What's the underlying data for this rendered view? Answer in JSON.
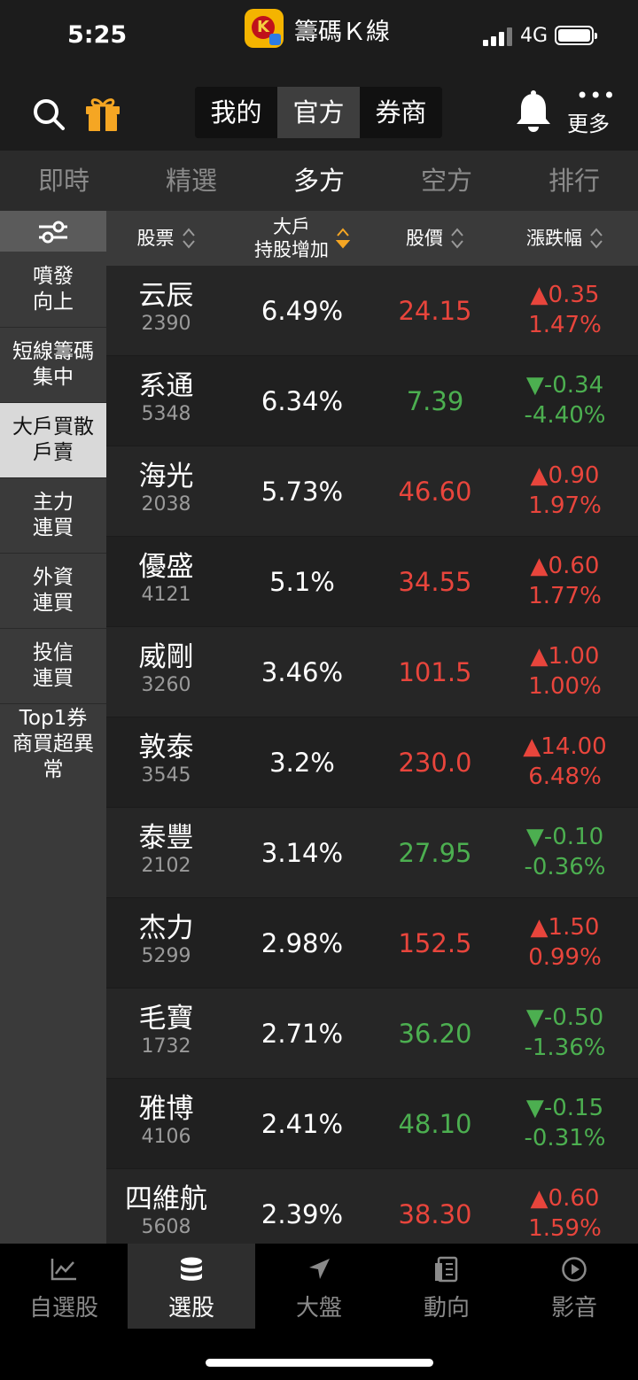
{
  "status": {
    "time": "5:25",
    "app_name": "籌碼Ｋ線",
    "network": "4G",
    "app_badge_letter": "K"
  },
  "header": {
    "segments": [
      {
        "label": "我的"
      },
      {
        "label": "官方"
      },
      {
        "label": "券商"
      }
    ],
    "active_segment": "官方",
    "more_label": "更多",
    "more_dots": "•••"
  },
  "tabs": [
    {
      "label": "即時"
    },
    {
      "label": "精選"
    },
    {
      "label": "多方"
    },
    {
      "label": "空方"
    },
    {
      "label": "排行"
    }
  ],
  "active_tab": "多方",
  "sidebar": {
    "items": [
      {
        "label": "噴發\n向上"
      },
      {
        "label": "短線籌碼\n集中"
      },
      {
        "label": "大戶買散\n戶賣"
      },
      {
        "label": "主力\n連買"
      },
      {
        "label": "外資\n連買"
      },
      {
        "label": "投信\n連買"
      },
      {
        "label": "Top1券\n商買超異\n常"
      }
    ],
    "active_item": "大戶買散戶賣"
  },
  "table": {
    "columns": [
      {
        "label": "股票"
      },
      {
        "label": "大戶\n持股增加"
      },
      {
        "label": "股價"
      },
      {
        "label": "漲跌幅"
      }
    ],
    "sorted_column": "大戶持股增加",
    "rows": [
      {
        "name": "云辰",
        "code": "2390",
        "pct": "6.49%",
        "price": "24.15",
        "change": "▲0.35",
        "change_pct": "1.47%",
        "dir": "up"
      },
      {
        "name": "系通",
        "code": "5348",
        "pct": "6.34%",
        "price": "7.39",
        "change": "▼-0.34",
        "change_pct": "-4.40%",
        "dir": "down"
      },
      {
        "name": "海光",
        "code": "2038",
        "pct": "5.73%",
        "price": "46.60",
        "change": "▲0.90",
        "change_pct": "1.97%",
        "dir": "up"
      },
      {
        "name": "優盛",
        "code": "4121",
        "pct": "5.1%",
        "price": "34.55",
        "change": "▲0.60",
        "change_pct": "1.77%",
        "dir": "up"
      },
      {
        "name": "威剛",
        "code": "3260",
        "pct": "3.46%",
        "price": "101.5",
        "change": "▲1.00",
        "change_pct": "1.00%",
        "dir": "up"
      },
      {
        "name": "敦泰",
        "code": "3545",
        "pct": "3.2%",
        "price": "230.0",
        "change": "▲14.00",
        "change_pct": "6.48%",
        "dir": "up"
      },
      {
        "name": "泰豐",
        "code": "2102",
        "pct": "3.14%",
        "price": "27.95",
        "change": "▼-0.10",
        "change_pct": "-0.36%",
        "dir": "down"
      },
      {
        "name": "杰力",
        "code": "5299",
        "pct": "2.98%",
        "price": "152.5",
        "change": "▲1.50",
        "change_pct": "0.99%",
        "dir": "up"
      },
      {
        "name": "毛寶",
        "code": "1732",
        "pct": "2.71%",
        "price": "36.20",
        "change": "▼-0.50",
        "change_pct": "-1.36%",
        "dir": "down"
      },
      {
        "name": "雅博",
        "code": "4106",
        "pct": "2.41%",
        "price": "48.10",
        "change": "▼-0.15",
        "change_pct": "-0.31%",
        "dir": "down"
      },
      {
        "name": "四維航",
        "code": "5608",
        "pct": "2.39%",
        "price": "38.30",
        "change": "▲0.60",
        "change_pct": "1.59%",
        "dir": "up"
      }
    ]
  },
  "bottom_nav": [
    {
      "label": "自選股",
      "icon": "chart-line-icon"
    },
    {
      "label": "選股",
      "icon": "database-icon"
    },
    {
      "label": "大盤",
      "icon": "navigation-arrow-icon"
    },
    {
      "label": "動向",
      "icon": "document-icon"
    },
    {
      "label": "影音",
      "icon": "play-circle-icon"
    }
  ],
  "active_nav": "選股",
  "colors": {
    "up": "#e8453c",
    "down": "#4caf50",
    "gift": "#f5a623",
    "sort_active": "#f5a623"
  }
}
